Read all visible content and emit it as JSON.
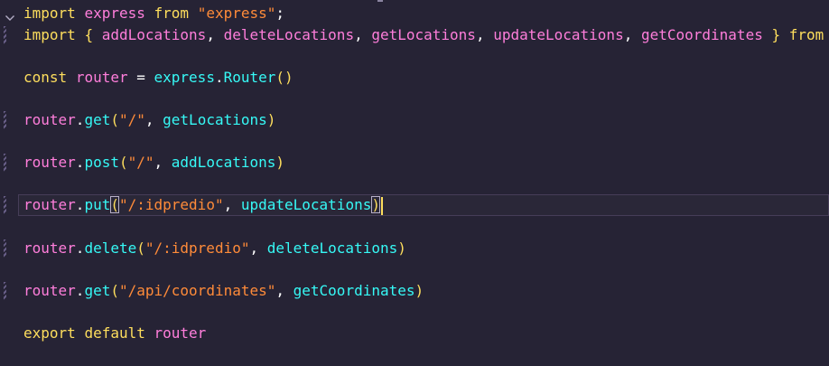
{
  "editor": {
    "lines": [
      {
        "tokens": [
          [
            "kw",
            "import"
          ],
          [
            "punc",
            " "
          ],
          [
            "var",
            "express"
          ],
          [
            "punc",
            " "
          ],
          [
            "kw",
            "from"
          ],
          [
            "punc",
            " "
          ],
          [
            "str",
            "\"express\""
          ],
          [
            "punc",
            ";"
          ]
        ],
        "modified": false,
        "fold": true
      },
      {
        "tokens": [
          [
            "kw",
            "import"
          ],
          [
            "punc",
            " "
          ],
          [
            "br",
            "{"
          ],
          [
            "punc",
            " "
          ],
          [
            "var",
            "addLocations"
          ],
          [
            "punc",
            ", "
          ],
          [
            "var",
            "deleteLocations"
          ],
          [
            "punc",
            ", "
          ],
          [
            "var",
            "getLocations"
          ],
          [
            "punc",
            ", "
          ],
          [
            "var",
            "updateLocations"
          ],
          [
            "punc",
            ", "
          ],
          [
            "var",
            "getCoordinates"
          ],
          [
            "punc",
            " "
          ],
          [
            "br",
            "}"
          ],
          [
            "punc",
            " "
          ],
          [
            "kw",
            "from"
          ]
        ],
        "modified": true
      },
      {
        "tokens": [],
        "modified": false
      },
      {
        "tokens": [
          [
            "kw",
            "const"
          ],
          [
            "punc",
            " "
          ],
          [
            "var",
            "router"
          ],
          [
            "punc",
            " = "
          ],
          [
            "fn",
            "express"
          ],
          [
            "punc",
            "."
          ],
          [
            "fn",
            "Router"
          ],
          [
            "br",
            "()"
          ]
        ],
        "modified": false
      },
      {
        "tokens": [],
        "modified": false
      },
      {
        "tokens": [
          [
            "var",
            "router"
          ],
          [
            "punc",
            "."
          ],
          [
            "fn",
            "get"
          ],
          [
            "br",
            "("
          ],
          [
            "str",
            "\"/\""
          ],
          [
            "punc",
            ", "
          ],
          [
            "fn",
            "getLocations"
          ],
          [
            "br",
            ")"
          ]
        ],
        "modified": true
      },
      {
        "tokens": [],
        "modified": false
      },
      {
        "tokens": [
          [
            "var",
            "router"
          ],
          [
            "punc",
            "."
          ],
          [
            "fn",
            "post"
          ],
          [
            "br",
            "("
          ],
          [
            "str",
            "\"/\""
          ],
          [
            "punc",
            ", "
          ],
          [
            "fn",
            "addLocations"
          ],
          [
            "br",
            ")"
          ]
        ],
        "modified": true
      },
      {
        "tokens": [],
        "modified": false
      },
      {
        "tokens": [
          [
            "var",
            "router"
          ],
          [
            "punc",
            "."
          ],
          [
            "fn",
            "put"
          ],
          [
            "brm",
            "("
          ],
          [
            "str",
            "\"/:idpredio\""
          ],
          [
            "punc",
            ", "
          ],
          [
            "fn",
            "updateLocations"
          ],
          [
            "brm",
            ")"
          ],
          [
            "cursor",
            ""
          ]
        ],
        "modified": true,
        "current": true
      },
      {
        "tokens": [],
        "modified": false
      },
      {
        "tokens": [
          [
            "var",
            "router"
          ],
          [
            "punc",
            "."
          ],
          [
            "fn",
            "delete"
          ],
          [
            "br",
            "("
          ],
          [
            "str",
            "\"/:idpredio\""
          ],
          [
            "punc",
            ", "
          ],
          [
            "fn",
            "deleteLocations"
          ],
          [
            "br",
            ")"
          ]
        ],
        "modified": true
      },
      {
        "tokens": [],
        "modified": false
      },
      {
        "tokens": [
          [
            "var",
            "router"
          ],
          [
            "punc",
            "."
          ],
          [
            "fn",
            "get"
          ],
          [
            "br",
            "("
          ],
          [
            "str",
            "\"/api/coordinates\""
          ],
          [
            "punc",
            ", "
          ],
          [
            "fn",
            "getCoordinates"
          ],
          [
            "br",
            ")"
          ]
        ],
        "modified": true
      },
      {
        "tokens": [],
        "modified": false
      },
      {
        "tokens": [
          [
            "kw",
            "export"
          ],
          [
            "punc",
            " "
          ],
          [
            "kw",
            "default"
          ],
          [
            "punc",
            " "
          ],
          [
            "var",
            "router"
          ]
        ],
        "modified": false
      }
    ]
  },
  "colors": {
    "background": "#262335",
    "keyword": "#fede5d",
    "function": "#36f9f6",
    "variable": "#ff7edb",
    "string": "#ff8b39"
  },
  "icons": {
    "fold": "chevron-down-icon"
  }
}
